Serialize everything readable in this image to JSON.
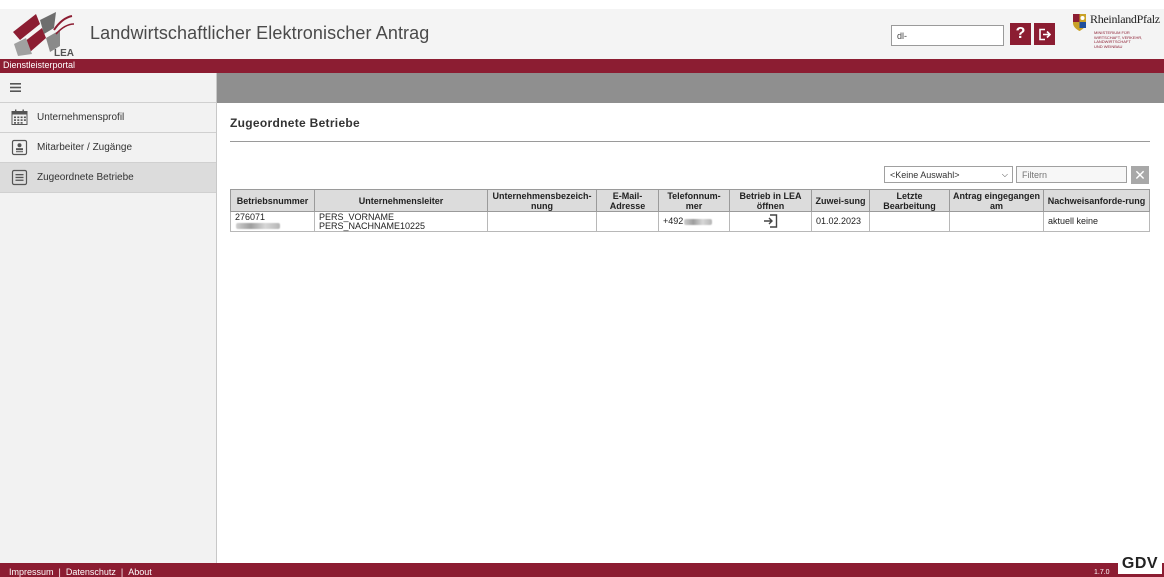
{
  "header": {
    "app_title": "Landwirtschaftlicher Elektronischer Antrag",
    "logo_text": "LEA",
    "user_field_value": "dl-",
    "help_label": "?",
    "state_name": "RheinlandPfalz",
    "ministry_lines": [
      "MINISTERIUM FÜR",
      "WIRTSCHAFT, VERKEHR,",
      "LANDWIRTSCHAFT",
      "UND WEINBAU"
    ]
  },
  "portal": {
    "label": "Dienstleisterportal"
  },
  "sidebar": {
    "menu_icon": "hamburger-icon",
    "items": [
      {
        "label": "Unternehmensprofil",
        "icon": "calendar-icon"
      },
      {
        "label": "Mitarbeiter / Zugänge",
        "icon": "contact-card-icon"
      },
      {
        "label": "Zugeordnete Betriebe",
        "icon": "document-list-icon"
      }
    ]
  },
  "main": {
    "title": "Zugeordnete Betriebe",
    "filter": {
      "select_value": "<Keine Auswahl>",
      "input_placeholder": "Filtern",
      "clear_label": "✕"
    },
    "table": {
      "columns": [
        "Betriebsnummer",
        "Unternehmensleiter",
        "Unternehmensbezeich-nung",
        "E-Mail-Adresse",
        "Telefonnum-mer",
        "Betrieb in LEA öffnen",
        "Zuwei-sung",
        "Letzte Bearbeitung",
        "Antrag eingegangen am",
        "Nachweisanforde-rung"
      ],
      "rows": [
        {
          "betriebsnummer": "276071",
          "leiter_line1": "PERS_VORNAME",
          "leiter_line2": "PERS_NACHNAME10225",
          "bezeichnung": "",
          "email": "",
          "telefon": "+492",
          "open_icon": "open-in-icon",
          "zuweisung": "01.02.2023",
          "letzte_bearbeitung": "",
          "antrag_eingegangen": "",
          "nachweis": "aktuell keine"
        }
      ]
    }
  },
  "footer": {
    "links": [
      "Impressum",
      "Datenschutz",
      "About"
    ],
    "version": "1.7.0",
    "brand": "GDV"
  },
  "colors": {
    "brand_red": "#8c1d32",
    "header_bg": "#f4f4f4",
    "sidebar_bg": "#f2f2f2",
    "greybar": "#8f8f8f"
  }
}
